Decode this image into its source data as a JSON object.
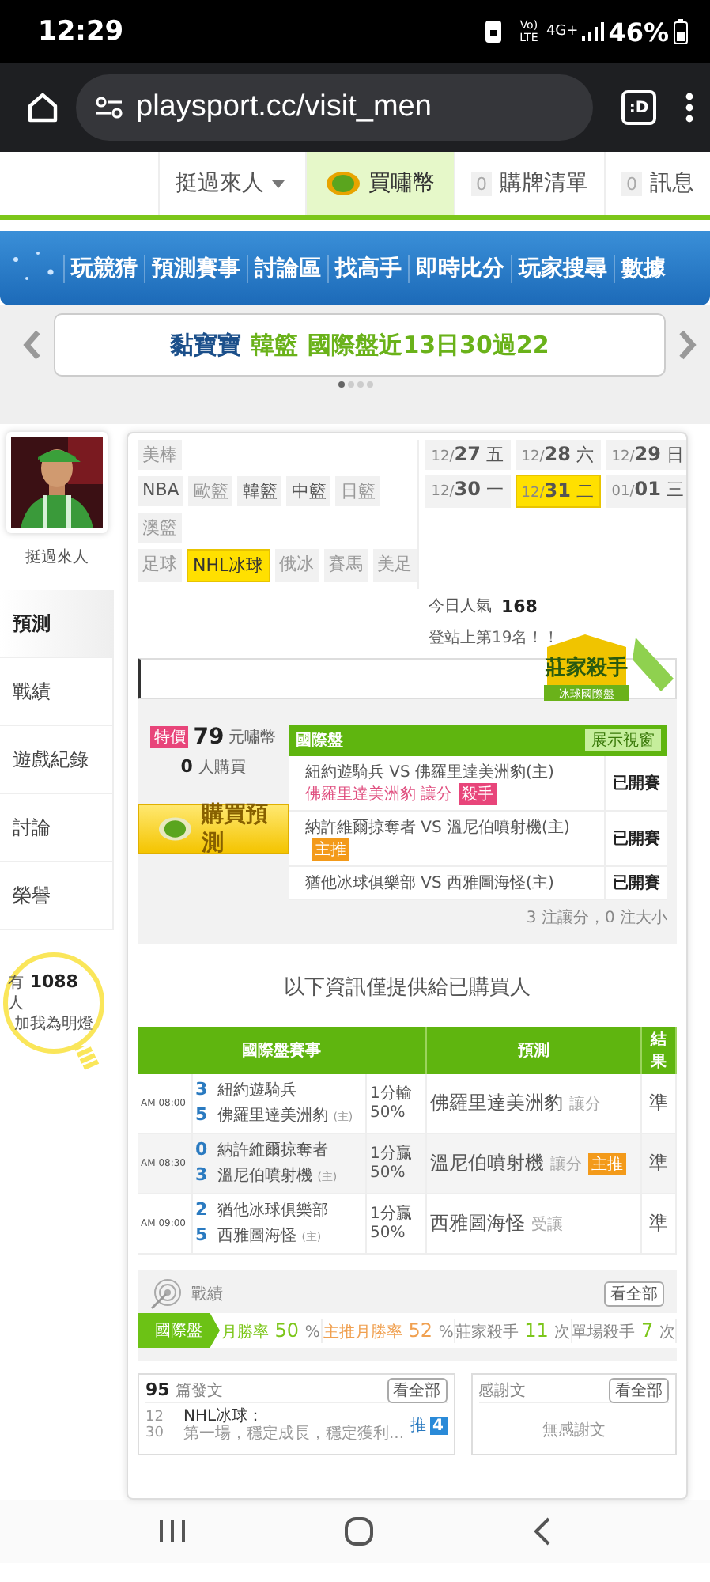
{
  "status_bar": {
    "time": "12:29",
    "volte": "Vo) LTE",
    "network": "4G+",
    "battery": "46%"
  },
  "browser": {
    "url": "playsport.cc/visit_men",
    "tabs_label": ":D"
  },
  "top_nav": {
    "user": "挺過來人",
    "buy": "買嘯幣",
    "cart_count": "0",
    "cart": "購牌清單",
    "msg_count": "0",
    "msg": "訊息"
  },
  "main_nav": [
    "玩競猜",
    "預測賽事",
    "討論區",
    "找高手",
    "即時比分",
    "玩家搜尋",
    "數據"
  ],
  "banner": {
    "name": "黏寶寶",
    "league": "韓籃",
    "record": "國際盤近13日30過22",
    "dots": [
      {
        "selected": true
      },
      {
        "selected": false
      },
      {
        "selected": false
      },
      {
        "selected": false
      }
    ]
  },
  "profile": {
    "name": "挺過來人"
  },
  "side_menu": [
    {
      "label": "預測",
      "selected": true
    },
    {
      "label": "戰績",
      "selected": false
    },
    {
      "label": "遊戲紀錄",
      "selected": false
    },
    {
      "label": "討論",
      "selected": false
    },
    {
      "label": "榮譽",
      "selected": false
    }
  ],
  "fans": {
    "prefix": "有",
    "count": "1088",
    "unit": "人",
    "caption": "加我為明燈"
  },
  "sport_filters": [
    {
      "items": [
        {
          "label": "美棒",
          "selected": false,
          "disabled": true
        }
      ]
    },
    {
      "items": [
        {
          "label": "NBA",
          "selected": false,
          "disabled": false
        },
        {
          "label": "歐籃",
          "selected": false,
          "disabled": true
        },
        {
          "label": "韓籃",
          "selected": false,
          "disabled": false
        },
        {
          "label": "中籃",
          "selected": false,
          "disabled": false
        },
        {
          "label": "日籃",
          "selected": false,
          "disabled": true
        }
      ]
    },
    {
      "items": [
        {
          "label": "澳籃",
          "selected": false,
          "disabled": true
        }
      ]
    },
    {
      "items": [
        {
          "label": "足球",
          "selected": false,
          "disabled": true
        },
        {
          "label": "NHL冰球",
          "selected": true,
          "disabled": false
        },
        {
          "label": "俄冰",
          "selected": false,
          "disabled": true
        },
        {
          "label": "賽馬",
          "selected": false,
          "disabled": true
        },
        {
          "label": "美足",
          "selected": false,
          "disabled": true
        }
      ]
    }
  ],
  "dates": [
    {
      "month": "12/",
      "day": "27",
      "weekday": "五",
      "selected": false
    },
    {
      "month": "12/",
      "day": "28",
      "weekday": "六",
      "selected": false
    },
    {
      "month": "12/",
      "day": "29",
      "weekday": "日",
      "selected": false
    },
    {
      "month": "12/",
      "day": "30",
      "weekday": "一",
      "selected": false
    },
    {
      "month": "12/",
      "day": "31",
      "weekday": "二",
      "selected": true
    },
    {
      "month": "01/",
      "day": "01",
      "weekday": "三",
      "selected": false
    }
  ],
  "popularity": {
    "label": "今日人氣",
    "value": "168",
    "rank": "登站上第19名！！"
  },
  "badge": {
    "title": "莊家殺手",
    "subtitle": "冰球國際盤"
  },
  "purchase": {
    "tag": "特價",
    "price": "79",
    "unit": "元嘯幣",
    "buyers": "0",
    "buyers_unit": "人購買",
    "button": "購買預測"
  },
  "pick_card": {
    "title": "國際盤",
    "button": "展示視窗",
    "rows": [
      {
        "away": "紐約遊騎兵",
        "vs": "VS",
        "home": "佛羅里達美洲豹(主)",
        "pick": "佛羅里達美洲豹  讓分",
        "tag": {
          "label": "殺手",
          "color": "#e8457a"
        },
        "status": "已開賽"
      },
      {
        "away": "納許維爾掠奪者",
        "vs": "VS",
        "home": "溫尼伯噴射機(主)",
        "tag": {
          "label": "主推",
          "color": "#f39a1a"
        },
        "status": "已開賽"
      },
      {
        "away": "猶他冰球俱樂部",
        "vs": "VS",
        "home": "西雅圖海怪(主)",
        "status": "已開賽"
      }
    ],
    "summary": "3 注讓分，0 注大小"
  },
  "notice": "以下資訊僅提供給已購買人",
  "results_table": {
    "columns": [
      "國際盤賽事",
      "預測",
      "結果"
    ],
    "rows": [
      {
        "time": "AM 08:00",
        "away_score": "3",
        "away": "紐約遊騎兵",
        "home_score": "5",
        "home": "佛羅里達美洲豹",
        "home_mark": "(主)",
        "line": "1分輸",
        "pct": "50%",
        "pick": "佛羅里達美洲豹",
        "pick_type": "讓分",
        "result": "準"
      },
      {
        "time": "AM 08:30",
        "away_score": "0",
        "away": "納許維爾掠奪者",
        "home_score": "3",
        "home": "溫尼伯噴射機",
        "home_mark": "(主)",
        "line": "1分贏",
        "pct": "50%",
        "pick": "溫尼伯噴射機",
        "pick_type": "讓分",
        "tag": "主推",
        "result": "準"
      },
      {
        "time": "AM 09:00",
        "away_score": "2",
        "away": "猶他冰球俱樂部",
        "home_score": "5",
        "home": "西雅圖海怪",
        "home_mark": "(主)",
        "line": "1分贏",
        "pct": "50%",
        "pick": "西雅圖海怪",
        "pick_type": "受讓",
        "result": "準"
      }
    ]
  },
  "record": {
    "title": "戰績",
    "button": "看全部",
    "tab": "國際盤",
    "stats": [
      {
        "label": "月勝率",
        "value": "50",
        "unit": "%",
        "color": "#7cc61a"
      },
      {
        "label": "主推月勝率",
        "value": "52",
        "unit": "%",
        "color": "#f0a050"
      },
      {
        "label": "莊家殺手",
        "value": "11",
        "unit": "次",
        "color": "#7cc61a"
      },
      {
        "label": "單場殺手",
        "value": "7",
        "unit": "次",
        "color": "#7cc61a"
      }
    ]
  },
  "posts": {
    "count": "95",
    "label": "篇發文",
    "button": "看全部",
    "items": [
      {
        "month": "12",
        "day": "30",
        "title": "NHL冰球：",
        "excerpt": "第一場，穩定成長，穩定獲利...",
        "push_label": "推",
        "push": "4"
      }
    ]
  },
  "thanks": {
    "title": "感謝文",
    "button": "看全部",
    "empty": "無感謝文"
  }
}
